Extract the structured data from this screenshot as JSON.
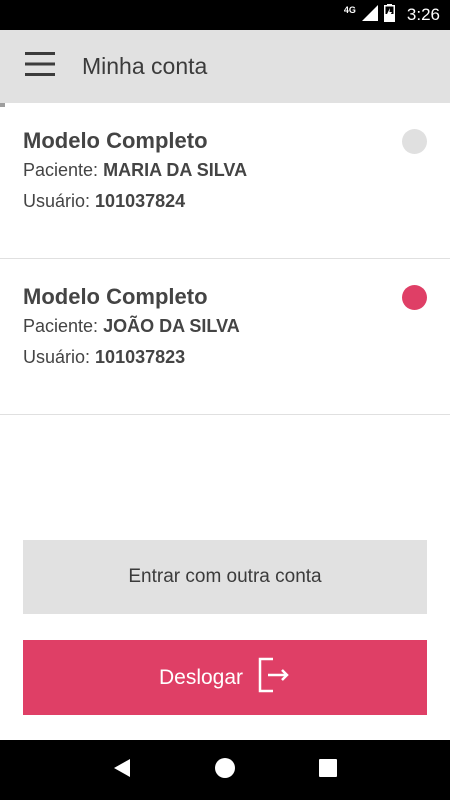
{
  "status_bar": {
    "network": "4G",
    "time": "3:26"
  },
  "app_bar": {
    "title": "Minha conta"
  },
  "accounts": [
    {
      "name": "Modelo Completo",
      "patient_label": "Paciente:",
      "patient": "MARIA DA SILVA",
      "user_label": "Usuário:",
      "user_id": "101037824",
      "status_color": "#e0e0e0"
    },
    {
      "name": "Modelo Completo",
      "patient_label": "Paciente:",
      "patient": "JOÃO DA SILVA",
      "user_label": "Usuário:",
      "user_id": "101037823",
      "status_color": "#df3f66"
    }
  ],
  "actions": {
    "other_account_label": "Entrar com outra conta",
    "logout_label": "Deslogar"
  },
  "colors": {
    "accent": "#df3f66",
    "app_bar_bg": "#e1e1e1"
  },
  "icons": {
    "menu": "hamburger-menu-icon",
    "logout": "logout-icon",
    "nav_back": "back-triangle-icon",
    "nav_home": "home-circle-icon",
    "nav_recent": "recent-square-icon"
  }
}
